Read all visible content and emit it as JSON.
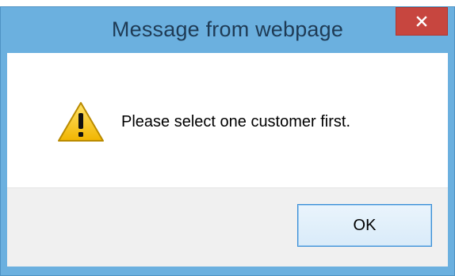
{
  "dialog": {
    "title": "Message from webpage",
    "close_icon": "close-icon",
    "warning_icon": "warning-icon",
    "message": "Please select one customer first.",
    "ok_label": "OK"
  },
  "colors": {
    "titlebar": "#6bb0df",
    "close_button": "#c7463f",
    "footer": "#f0f0f0",
    "ok_border": "#3c8fd6",
    "warning_fill": "#f4c21d"
  }
}
